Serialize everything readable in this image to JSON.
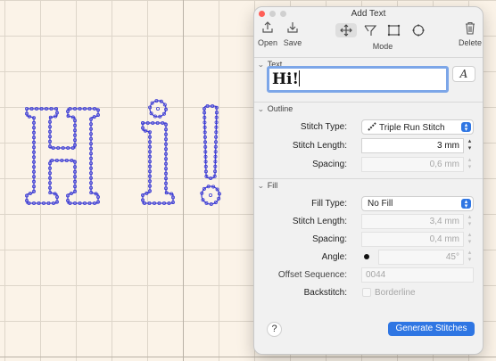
{
  "window": {
    "title": "Add Text"
  },
  "toolbar": {
    "open_label": "Open",
    "save_label": "Save",
    "mode_label": "Mode",
    "delete_label": "Delete",
    "mode_tools": [
      "move-icon",
      "lasso-icon",
      "rectangle-select-icon",
      "circle-select-icon"
    ],
    "active_mode": "move-icon"
  },
  "text_section": {
    "title": "Text",
    "value": "Hi!",
    "font_button": "A"
  },
  "outline": {
    "title": "Outline",
    "stitch_type_label": "Stitch Type:",
    "stitch_type_value": "Triple Run Stitch",
    "stitch_length_label": "Stitch Length:",
    "stitch_length_value": "3 mm",
    "spacing_label": "Spacing:",
    "spacing_value": "0,6 mm"
  },
  "fill": {
    "title": "Fill",
    "fill_type_label": "Fill Type:",
    "fill_type_value": "No Fill",
    "stitch_length_label": "Stitch Length:",
    "stitch_length_value": "3,4 mm",
    "spacing_label": "Spacing:",
    "spacing_value": "0,4 mm",
    "angle_label": "Angle:",
    "angle_value": "45°",
    "offset_label": "Offset Sequence:",
    "offset_placeholder": "0044",
    "backstitch_label": "Backstitch:",
    "backstitch_option": "Borderline",
    "backstitch_checked": false
  },
  "footer": {
    "help_label": "?",
    "generate_label": "Generate Stitches"
  },
  "colors": {
    "accent": "#2f76e3",
    "stitch": "#3b3bd4",
    "canvas": "#fbf3e8"
  }
}
